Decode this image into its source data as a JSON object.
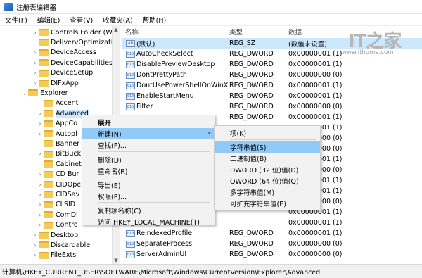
{
  "window": {
    "title": "注册表编辑器"
  },
  "menubar": [
    "文件(F)",
    "编辑(E)",
    "查看(V)",
    "收藏夹(A)",
    "帮助(H)"
  ],
  "tree": [
    {
      "label": "Controls Folder (Wo",
      "arrow": "›"
    },
    {
      "label": "DelivervOptimization",
      "arrow": ""
    },
    {
      "label": "DeviceAccess",
      "arrow": "›"
    },
    {
      "label": "DeviceCapabilities",
      "arrow": "›"
    },
    {
      "label": "DeviceSetup",
      "arrow": "›"
    },
    {
      "label": "DIFxApp",
      "arrow": "›"
    },
    {
      "label": "Explorer",
      "arrow": "⌄"
    },
    {
      "label": "Accent",
      "arrow": ""
    },
    {
      "label": "Advanced",
      "arrow": "›"
    },
    {
      "label": "AppCo",
      "arrow": "›"
    },
    {
      "label": "Autopl",
      "arrow": "›"
    },
    {
      "label": "Banner",
      "arrow": ""
    },
    {
      "label": "BitBuck",
      "arrow": "›"
    },
    {
      "label": "Cabinet",
      "arrow": ""
    },
    {
      "label": "CD Bur",
      "arrow": "›"
    },
    {
      "label": "CIDOpe",
      "arrow": "›"
    },
    {
      "label": "CIDSav",
      "arrow": "›"
    },
    {
      "label": "CLSID",
      "arrow": "›"
    },
    {
      "label": "ComDl",
      "arrow": "›"
    },
    {
      "label": "Contro",
      "arrow": "›"
    },
    {
      "label": "Desktop",
      "arrow": "›"
    },
    {
      "label": "Discardable",
      "arrow": "›"
    },
    {
      "label": "FileExts",
      "arrow": "›"
    }
  ],
  "columns": {
    "name": "名称",
    "type": "类型",
    "data": "数据"
  },
  "values": [
    {
      "icon": "ab",
      "name": "(默认)",
      "type": "REG_SZ",
      "data": "(数值未设置)"
    },
    {
      "icon": "010",
      "name": "AutoCheckSelect",
      "type": "REG_DWORD",
      "data": "0x00000001 (1)"
    },
    {
      "icon": "010",
      "name": "DisablePreviewDesktop",
      "type": "REG_DWORD",
      "data": "0x00000001 (1)"
    },
    {
      "icon": "010",
      "name": "DontPrettyPath",
      "type": "REG_DWORD",
      "data": "0x00000000 (0)"
    },
    {
      "icon": "010",
      "name": "DontUsePowerShellOnWinX",
      "type": "REG_DWORD",
      "data": "0x00000001 (1)"
    },
    {
      "icon": "010",
      "name": "EnableStartMenu",
      "type": "REG_DWORD",
      "data": "0x00000001 (1)"
    },
    {
      "icon": "010",
      "name": "Filter",
      "type": "REG_DWORD",
      "data": "0x00000000 (0)"
    },
    {
      "icon": "",
      "name": "",
      "type": "REG_DWORD",
      "data": "0x00000001 (1)"
    },
    {
      "icon": "",
      "name": "",
      "type": "",
      "data": "0x00000001 (1)"
    },
    {
      "icon": "",
      "name": "",
      "type": "",
      "data": "0x00000000 (0)"
    },
    {
      "icon": "",
      "name": "",
      "type": "",
      "data": "0x00000000 (0)"
    },
    {
      "icon": "",
      "name": "",
      "type": "",
      "data": "0x00000001 (1)"
    },
    {
      "icon": "",
      "name": "",
      "type": "",
      "data": "0x00000000 (0)"
    },
    {
      "icon": "",
      "name": "",
      "type": "",
      "data": "0x00000001 (1)"
    },
    {
      "icon": "",
      "name": "",
      "type": "",
      "data": "0x00000001 (1)"
    },
    {
      "icon": "",
      "name": "",
      "type": "",
      "data": "0x00000000 (0)"
    },
    {
      "icon": "",
      "name": "",
      "type": "",
      "data": "0x00000001 (1)"
    },
    {
      "icon": "",
      "name": "",
      "type": "",
      "data": "0x00000001 (1)"
    },
    {
      "icon": "010",
      "name": "ReindexedProfile",
      "type": "REG_DWORD",
      "data": "0x00000001 (1)"
    },
    {
      "icon": "010",
      "name": "SeparateProcess",
      "type": "REG_DWORD",
      "data": "0x00000000 (0)"
    },
    {
      "icon": "010",
      "name": "ServerAdminUI",
      "type": "REG_DWORD",
      "data": "0x00000000 (0)"
    }
  ],
  "context_menu": [
    {
      "label": "展开",
      "bold": true
    },
    {
      "label": "新建(N)",
      "submenu": true,
      "highlight": true
    },
    {
      "label": "查找(F)..."
    },
    {
      "label": "删除(D)"
    },
    {
      "label": "重命名(R)"
    },
    {
      "label": "导出(E)"
    },
    {
      "label": "权限(P)..."
    },
    {
      "label": "复制项名称(C)"
    },
    {
      "label": "访问 HKEY_LOCAL_MACHINE(T)"
    }
  ],
  "submenu": [
    {
      "label": "项(K)"
    },
    {
      "label": "字符串值(S)",
      "highlight": true
    },
    {
      "label": "二进制值(B)"
    },
    {
      "label": "DWORD (32 位)值(D)"
    },
    {
      "label": "QWORD (64 位)值(Q)"
    },
    {
      "label": "多字符串值(M)"
    },
    {
      "label": "可扩充字符串值(E)"
    }
  ],
  "status": {
    "path": "计算机\\HKEY_CURRENT_USER\\SOFTWARE\\Microsoft\\Windows\\CurrentVersion\\Explorer\\Advanced"
  },
  "watermark": {
    "logo": "IT之家",
    "url": "www.ithome.com"
  }
}
